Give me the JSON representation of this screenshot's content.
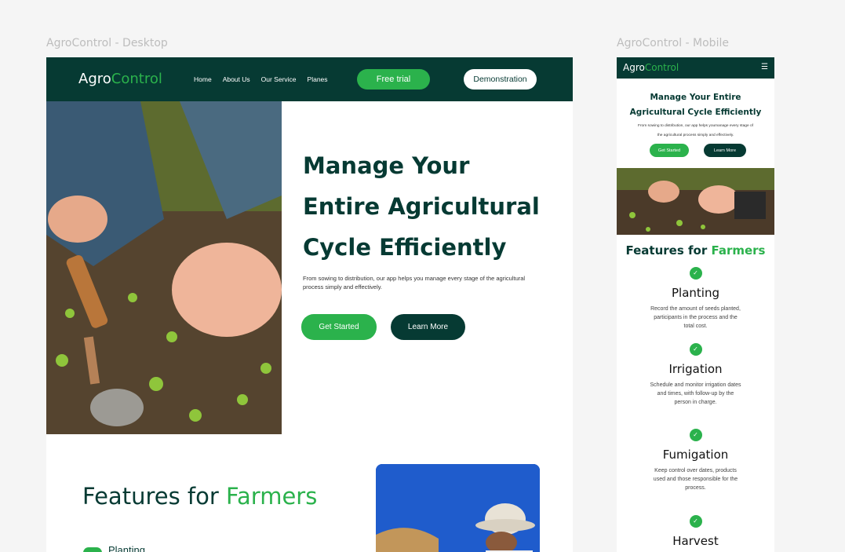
{
  "desktop": {
    "frame_label": "AgroControl - Desktop",
    "nav": {
      "logo_part1": "Agro",
      "logo_part2": "Control",
      "links": [
        "Home",
        "About Us",
        "Our Service",
        "Planes"
      ],
      "trial_label": "Free trial",
      "demo_label": "Demonstration"
    },
    "hero": {
      "title": "Manage Your Entire Agricultural Cycle Efficiently",
      "subtitle": "From sowing to distribution, our app helps you manage every stage of the agricultural process simply and effectively.",
      "start_label": "Get Started",
      "learn_label": "Learn More"
    },
    "features": {
      "title_part1": "Features for ",
      "title_part2": "Farmers",
      "first_item": "Planting"
    }
  },
  "mobile": {
    "frame_label": "AgroControl - Mobile",
    "nav": {
      "logo_part1": "Agro",
      "logo_part2": "Control",
      "menu_icon": "hamburger-icon"
    },
    "hero": {
      "title": "Manage Your Entire Agricultural Cycle Efficiently",
      "subtitle": "From sowing to distribution, our app helps youmanage every stage of the agricultural process simply and effectively.",
      "start_label": "Get Started",
      "learn_label": "Learn More"
    },
    "features": {
      "title_part1": "Features for ",
      "title_part2": "Farmers",
      "items": [
        {
          "name": "Planting",
          "desc": "Record the amount of seeds planted, participants in the process and the total cost."
        },
        {
          "name": "Irrigation",
          "desc": "Schedule and monitor irrigation dates and times, with follow-up by the person in charge."
        },
        {
          "name": "Fumigation",
          "desc": "Keep control over dates, products used and those responsible for the process."
        },
        {
          "name": "Harvest",
          "desc": ""
        }
      ]
    }
  },
  "colors": {
    "primary_dark": "#063a33",
    "accent_green": "#2bb24c"
  }
}
